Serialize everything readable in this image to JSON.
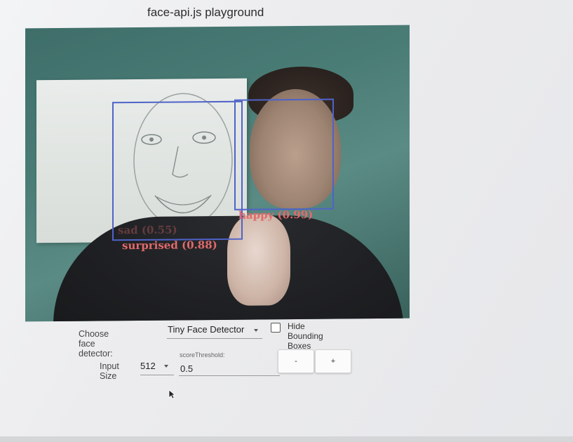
{
  "page": {
    "title": "face-api.js playground"
  },
  "video": {
    "detections": [
      {
        "expression_label": "sad (0.55)"
      },
      {
        "expression_label": "surprised (0.88)"
      },
      {
        "expression_label": "happy (0.99)"
      }
    ]
  },
  "controls": {
    "face_detector": {
      "label": "Choose face detector:",
      "value": "Tiny Face Detector"
    },
    "hide_bounding_boxes": {
      "label": "Hide Bounding Boxes",
      "checked": false
    },
    "input_size": {
      "label": "Input Size",
      "value": "512"
    },
    "score_threshold": {
      "label": "scoreThreshold:",
      "value": "0.5"
    },
    "decrease_label": "-",
    "increase_label": "+"
  },
  "colors": {
    "bounding_box": "#4f63c9",
    "expression_label": "#e26a6a"
  }
}
